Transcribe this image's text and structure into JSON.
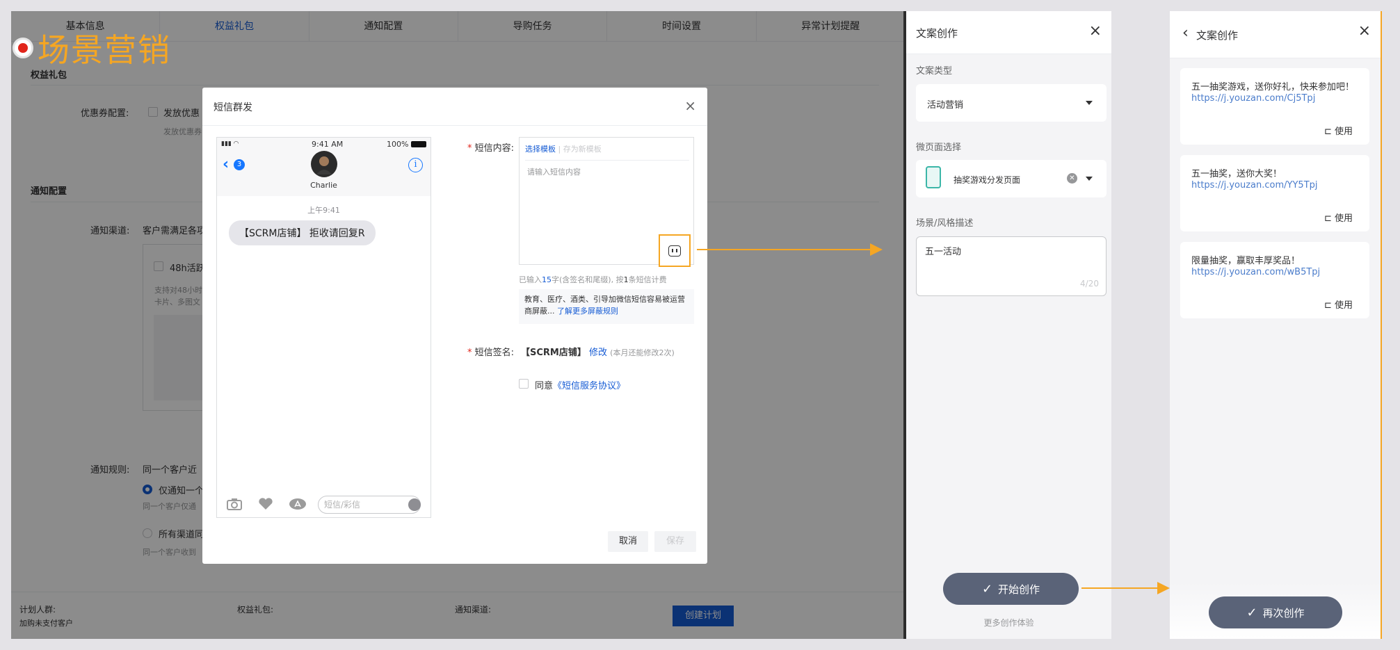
{
  "brand": {
    "title": "场景营销"
  },
  "bg": {
    "tabs": [
      "基本信息",
      "权益礼包",
      "通知配置",
      "导购任务",
      "时间设置",
      "异常计划提醒"
    ],
    "active_tab": 1,
    "sec_gift": "权益礼包",
    "coupon_label": "优惠券配置:",
    "coupon_cb": "发放优惠",
    "coupon_sub": "发放优惠券",
    "sec_notify": "通知配置",
    "channel_label": "通知渠道:",
    "channel_text": "客户需满足各项",
    "h48": "48h活跃",
    "h48_sub1": "支持对48小时",
    "h48_sub2": "卡片、多图文",
    "rule_label": "通知规则:",
    "rule_text": "同一个客户近",
    "rule_opt1": "仅通知一个",
    "rule_opt1_sub": "同一个客户仅通",
    "rule_opt2": "所有渠道同",
    "rule_opt2_sub": "同一个客户收到",
    "footer": {
      "crowd_label": "计划人群:",
      "crowd_val": "加购未支付客户",
      "gift_label": "权益礼包:",
      "channel_label": "通知渠道:",
      "create_btn": "创建计划"
    }
  },
  "modal": {
    "title": "短信群发",
    "close": "×",
    "phone": {
      "time": "9:41 AM",
      "battery": "100%",
      "count": "3",
      "contact": "Charlie",
      "timestamp": "上午9:41",
      "bubble": "【SCRM店铺】 拒收请回复R",
      "input_placeholder": "短信/彩信"
    },
    "content_label": "短信内容:",
    "tab_template": "选择模板",
    "tab_save": "存为新模板",
    "placeholder": "请输入短信内容",
    "counter_pre": "已输入",
    "counter_n": "15",
    "counter_mid": "字(含签名和尾缀), 按",
    "counter_m": "1",
    "counter_post": "条短信计费",
    "notice": "教育、医疗、酒类、引导加微信短信容易被运营商屏蔽... ",
    "notice_link": "了解更多屏蔽规则",
    "sign_label": "短信签名:",
    "sign_value": "【SCRM店铺】",
    "sign_edit": "修改",
    "sign_hint": "(本月还能修改2次)",
    "agree": "同意",
    "agree_link": "《短信服务协议》",
    "cancel": "取消",
    "save": "保存"
  },
  "panel1": {
    "title": "文案创作",
    "type_label": "文案类型",
    "type_value": "活动营销",
    "page_label": "微页面选择",
    "page_value": "抽奖游戏分发页面",
    "desc_label": "场景/风格描述",
    "desc_value": "五一活动",
    "desc_count": "4/20",
    "gen_btn": "开始创作",
    "more": "更多创作体验"
  },
  "panel2": {
    "title": "文案创作",
    "cards": [
      {
        "text": "五一抽奖游戏，送你好礼，快来参加吧！",
        "url": "https://j.youzan.com/Cj5Tpj",
        "use": "使用"
      },
      {
        "text": "五一抽奖，送你大奖！",
        "url": "https://j.youzan.com/YY5Tpj",
        "use": "使用"
      },
      {
        "text": "限量抽奖，赢取丰厚奖品！",
        "url": "https://j.youzan.com/wB5Tpj",
        "use": "使用"
      }
    ],
    "regen_btn": "再次创作"
  },
  "colors": {
    "accent": "#f5a623",
    "primary": "#155bd4",
    "button_dark": "#5a6378"
  }
}
